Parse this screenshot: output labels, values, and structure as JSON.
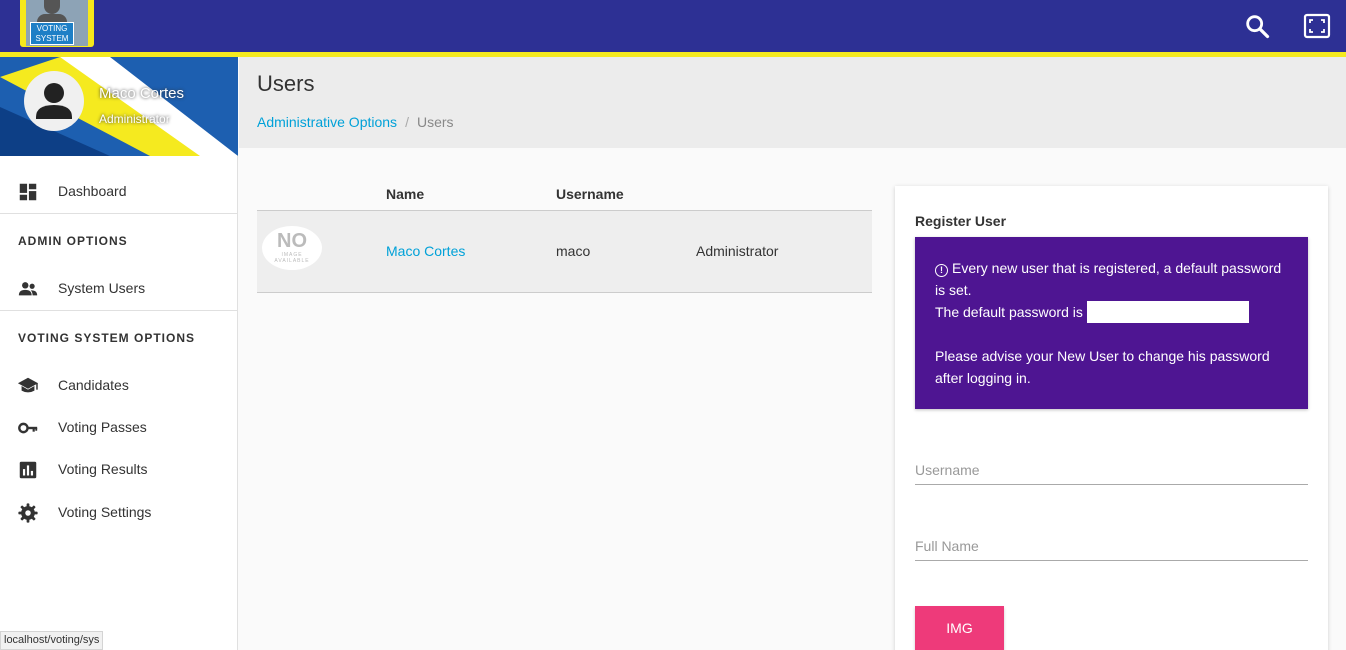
{
  "topbar": {
    "logo_text_line1": "VOTING",
    "logo_text_line2": "SYSTEM",
    "search_icon": "search-icon",
    "fullscreen_icon": "fullscreen-icon"
  },
  "user": {
    "name": "Maco Cortes",
    "role": "Administrator",
    "avatar_icon": "person-icon"
  },
  "sidebar": {
    "dashboard": {
      "label": "Dashboard",
      "icon": "dashboard-icon"
    },
    "section_admin": "ADMIN OPTIONS",
    "system_users": {
      "label": "System Users",
      "icon": "people-icon"
    },
    "section_voting": "VOTING SYSTEM OPTIONS",
    "candidates": {
      "label": "Candidates",
      "icon": "graduation-cap-icon"
    },
    "voting_passes": {
      "label": "Voting Passes",
      "icon": "key-icon"
    },
    "voting_results": {
      "label": "Voting Results",
      "icon": "chart-icon"
    },
    "voting_settings": {
      "label": "Voting Settings",
      "icon": "gear-icon"
    }
  },
  "status_url": "localhost/voting/sys",
  "page": {
    "title": "Users",
    "breadcrumb": {
      "parent": "Administrative Options",
      "separator": "/",
      "current": "Users"
    }
  },
  "table": {
    "columns": [
      "",
      "Name",
      "Username",
      ""
    ],
    "rows": [
      {
        "image_big": "NO",
        "image_small_1": "IMAGE",
        "image_small_2": "AVAILABLE",
        "name": "Maco Cortes",
        "username": "maco",
        "role": "Administrator"
      }
    ]
  },
  "register": {
    "title": "Register User",
    "info_line1": "Every new user that is registered, a default password is set.",
    "info_line2": "The default password is",
    "info_line3": "Please advise your New User to change his password after logging in.",
    "username_placeholder": "Username",
    "fullname_placeholder": "Full Name",
    "img_button": "IMG"
  },
  "colors": {
    "topbar": "#2d3094",
    "stripe": "#f5ea1f",
    "link": "#00a1d8",
    "info_box": "#4e1592",
    "img_button": "#ee3a7a"
  }
}
